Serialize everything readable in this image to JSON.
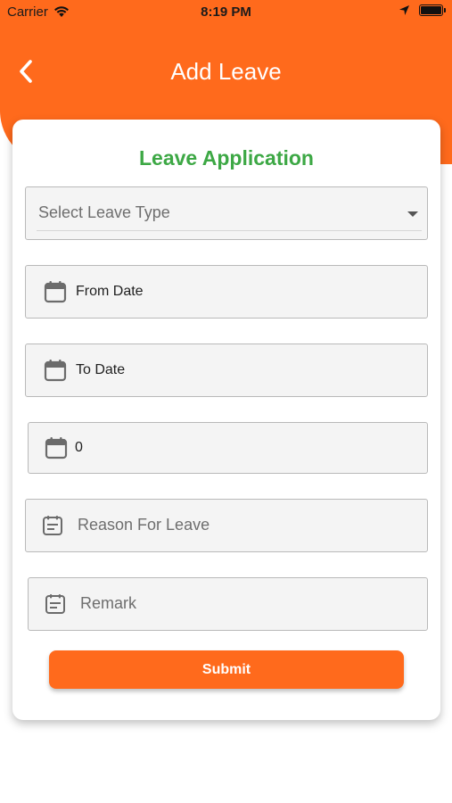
{
  "status_bar": {
    "carrier": "Carrier",
    "time": "8:19 PM"
  },
  "header": {
    "title": "Add Leave",
    "back_icon": "chevron-left-icon"
  },
  "form": {
    "title": "Leave Application",
    "leave_type_placeholder": "Select Leave Type",
    "from_date_label": "From Date",
    "to_date_label": "To Date",
    "days_value": "0",
    "reason_placeholder": "Reason For Leave",
    "remark_placeholder": "Remark",
    "submit_label": "Submit"
  },
  "colors": {
    "accent": "#FF6A1C",
    "title_green": "#3DA845"
  }
}
